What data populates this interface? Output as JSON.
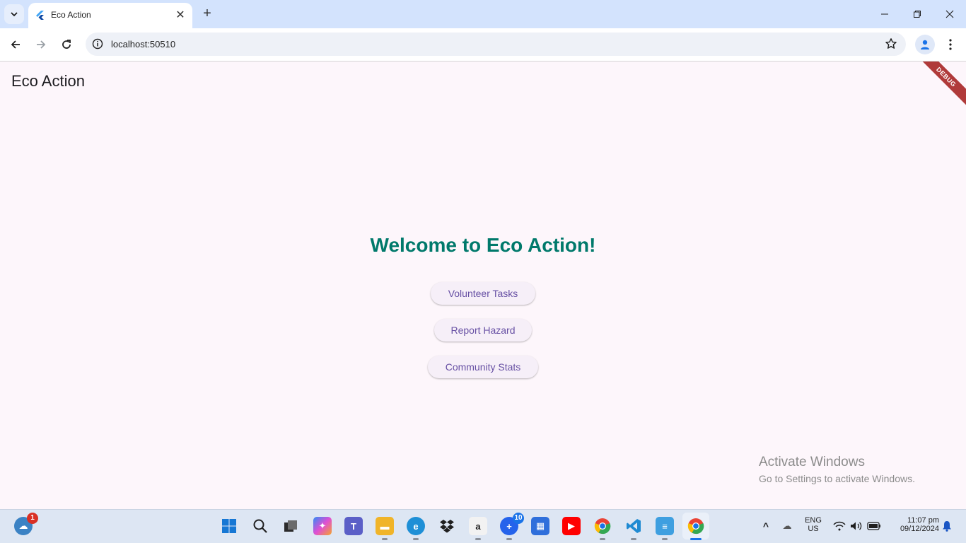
{
  "browser": {
    "tab_title": "Eco Action",
    "url": "localhost:50510"
  },
  "app": {
    "appbar_title": "Eco Action",
    "debug_label": "DEBUG",
    "welcome": "Welcome to Eco Action!",
    "buttons": {
      "volunteer": "Volunteer Tasks",
      "report": "Report Hazard",
      "stats": "Community Stats"
    },
    "colors": {
      "heading": "#00796b",
      "button_text": "#6750a4",
      "background": "#fdf6fb"
    }
  },
  "watermark": {
    "title": "Activate Windows",
    "subtitle": "Go to Settings to activate Windows."
  },
  "taskbar": {
    "weather_badge": "1",
    "copilot_badge": "10",
    "lang_line1": "ENG",
    "lang_line2": "US",
    "time": "11:07 pm",
    "date": "09/12/2024"
  }
}
